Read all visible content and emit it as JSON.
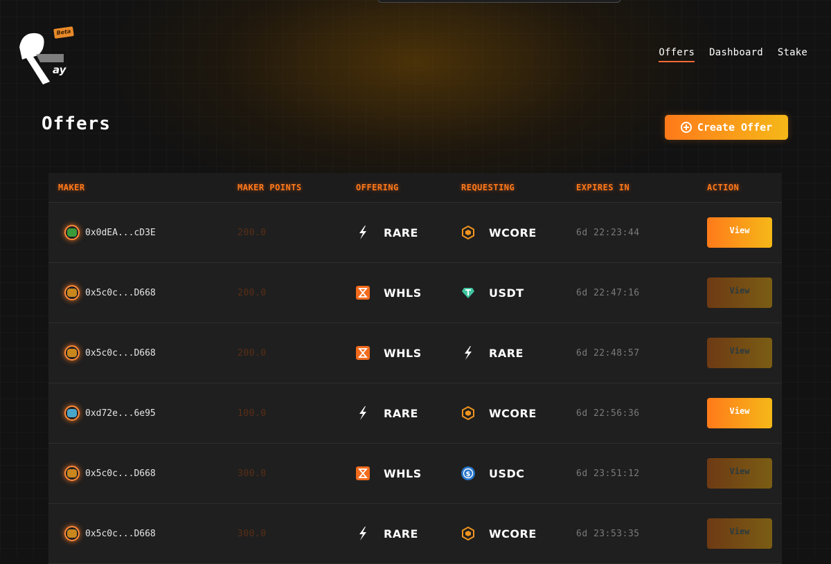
{
  "header": {
    "beta_label": "Beta",
    "logo_text": "ay",
    "nav": [
      {
        "label": "Offers",
        "active": true
      },
      {
        "label": "Dashboard",
        "active": false
      },
      {
        "label": "Stake",
        "active": false
      }
    ]
  },
  "page": {
    "title": "Offers",
    "create_label": "Create Offer"
  },
  "table": {
    "columns": [
      "MAKER",
      "MAKER POINTS",
      "OFFERING",
      "REQUESTING",
      "EXPIRES IN",
      "ACTION"
    ],
    "rows": [
      {
        "maker": "0x0dEA...cD3E",
        "avatar": "green",
        "points": "200.0",
        "offering": "RARE",
        "offering_icon": "bolt-icon",
        "requesting": "WCORE",
        "requesting_icon": "hex-icon",
        "expires": "6d 22:23:44",
        "action": "View",
        "enabled": true
      },
      {
        "maker": "0x5c0c...D668",
        "avatar": "orange",
        "points": "200.0",
        "offering": "WHLS",
        "offering_icon": "hourglass-icon",
        "requesting": "USDT",
        "requesting_icon": "tether-icon",
        "expires": "6d 22:47:16",
        "action": "View",
        "enabled": false
      },
      {
        "maker": "0x5c0c...D668",
        "avatar": "orange",
        "points": "200.0",
        "offering": "WHLS",
        "offering_icon": "hourglass-icon",
        "requesting": "RARE",
        "requesting_icon": "bolt-icon",
        "expires": "6d 22:48:57",
        "action": "View",
        "enabled": false
      },
      {
        "maker": "0xd72e...6e95",
        "avatar": "blue",
        "points": "100.0",
        "offering": "RARE",
        "offering_icon": "bolt-icon",
        "requesting": "WCORE",
        "requesting_icon": "hex-icon",
        "expires": "6d 22:56:36",
        "action": "View",
        "enabled": true
      },
      {
        "maker": "0x5c0c...D668",
        "avatar": "orange",
        "points": "300.0",
        "offering": "WHLS",
        "offering_icon": "hourglass-icon",
        "requesting": "USDC",
        "requesting_icon": "usdc-icon",
        "expires": "6d 23:51:12",
        "action": "View",
        "enabled": false
      },
      {
        "maker": "0x5c0c...D668",
        "avatar": "orange",
        "points": "300.0",
        "offering": "RARE",
        "offering_icon": "bolt-icon",
        "requesting": "WCORE",
        "requesting_icon": "hex-icon",
        "expires": "6d 23:53:35",
        "action": "View",
        "enabled": false
      }
    ]
  },
  "colors": {
    "accent": "#ff7a1a",
    "accent_end": "#f5b818",
    "background": "#121212",
    "row": "#1f1f1f"
  }
}
